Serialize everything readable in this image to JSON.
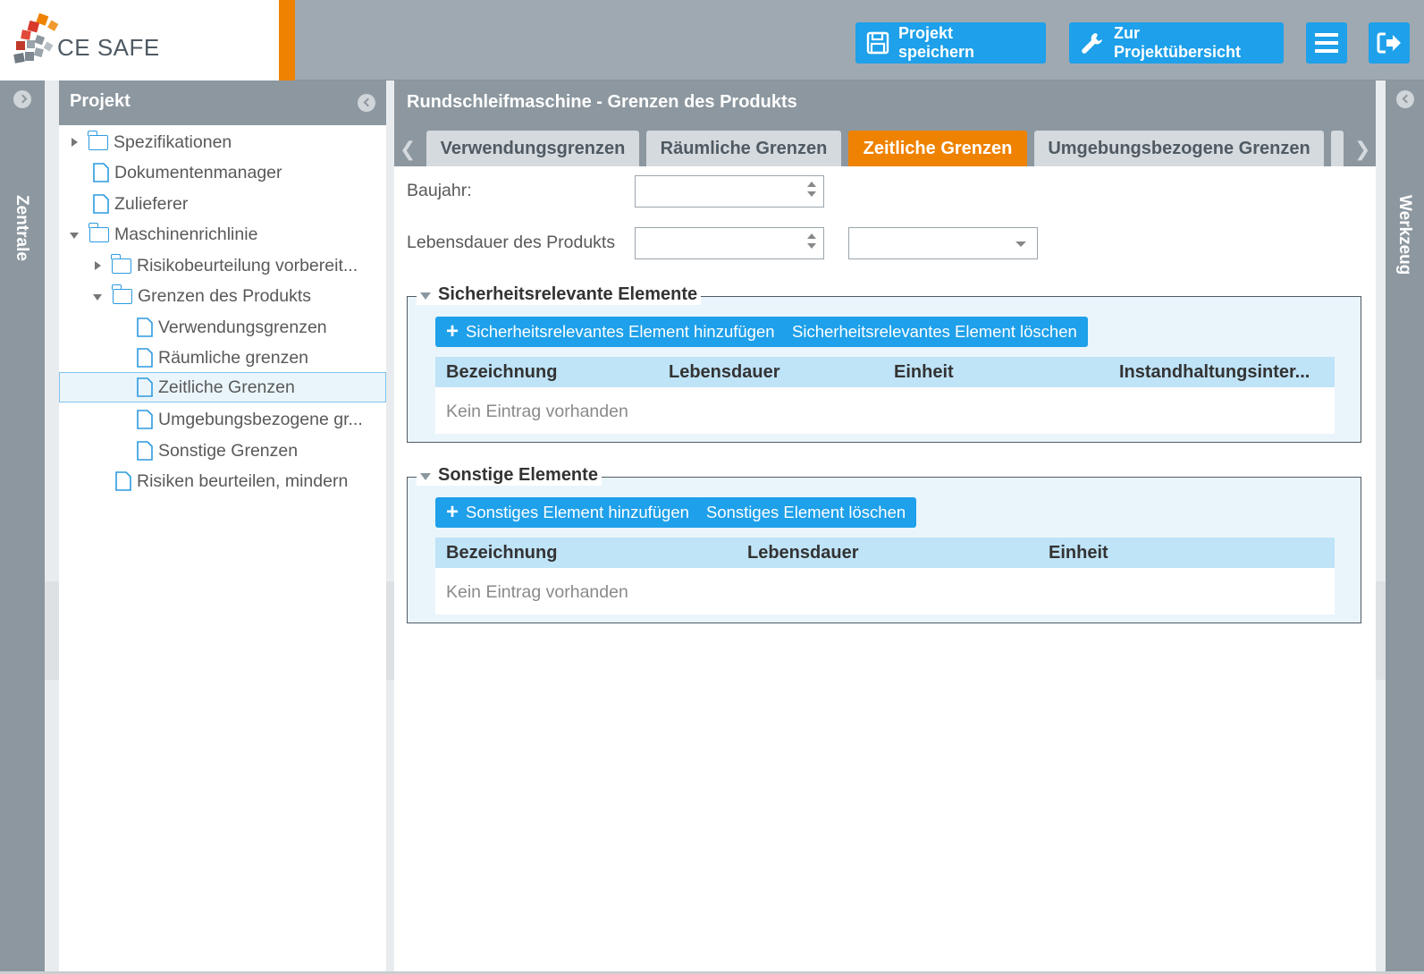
{
  "app": {
    "logo_text": "CE SAFE",
    "brand_orange": "#ef8200",
    "brand_blue": "#1ea0ea"
  },
  "header": {
    "save_label": "Projekt speichern",
    "overview_label": "Zur Projektübersicht",
    "menu_icon": "hamburger-icon",
    "logout_icon": "logout-icon"
  },
  "side_left": {
    "label": "Zentrale"
  },
  "side_right": {
    "label": "Werkzeug"
  },
  "tree": {
    "title": "Projekt",
    "items": [
      {
        "label": "Spezifikationen",
        "type": "folder",
        "expander": "collapsed"
      },
      {
        "label": "Dokumentenmanager",
        "type": "file"
      },
      {
        "label": "Zulieferer",
        "type": "file"
      },
      {
        "label": "Maschinenrichlinie",
        "type": "folder",
        "expander": "expanded"
      },
      {
        "label": "Risikobeurteilung vorbereit...",
        "type": "folder",
        "expander": "collapsed"
      },
      {
        "label": "Grenzen des Produkts",
        "type": "folder",
        "expander": "expanded"
      },
      {
        "label": "Verwendungsgrenzen",
        "type": "file"
      },
      {
        "label": "Räumliche grenzen",
        "type": "file"
      },
      {
        "label": "Zeitliche Grenzen",
        "type": "file",
        "selected": true
      },
      {
        "label": "Umgebungsbezogene gr...",
        "type": "file"
      },
      {
        "label": "Sonstige Grenzen",
        "type": "file"
      },
      {
        "label": "Risiken beurteilen, mindern",
        "type": "file"
      }
    ]
  },
  "main": {
    "title": "Rundschleifmaschine - Grenzen des Produkts",
    "tabs": [
      {
        "label": "Verwendungsgrenzen",
        "active": false
      },
      {
        "label": "Räumliche Grenzen",
        "active": false
      },
      {
        "label": "Zeitliche Grenzen",
        "active": true
      },
      {
        "label": "Umgebungsbezogene Grenzen",
        "active": false
      }
    ],
    "form": {
      "baujahr_label": "Baujahr:",
      "baujahr_value": "",
      "lebensdauer_label": "Lebensdauer des Produkts",
      "lebensdauer_value": "",
      "lebensdauer_unit": ""
    },
    "safety": {
      "title": "Sicherheitsrelevante Elemente",
      "add_label": "Sicherheitsrelevantes Element hinzufügen",
      "delete_label": "Sicherheitsrelevantes Element löschen",
      "columns": [
        "Bezeichnung",
        "Lebensdauer",
        "Einheit",
        "Instandhaltungsinter..."
      ],
      "empty_text": "Kein Eintrag vorhanden"
    },
    "other": {
      "title": "Sonstige Elemente",
      "add_label": "Sonstiges Element hinzufügen",
      "delete_label": "Sonstiges Element löschen",
      "columns": [
        "Bezeichnung",
        "Lebensdauer",
        "Einheit"
      ],
      "empty_text": "Kein Eintrag vorhanden"
    }
  }
}
